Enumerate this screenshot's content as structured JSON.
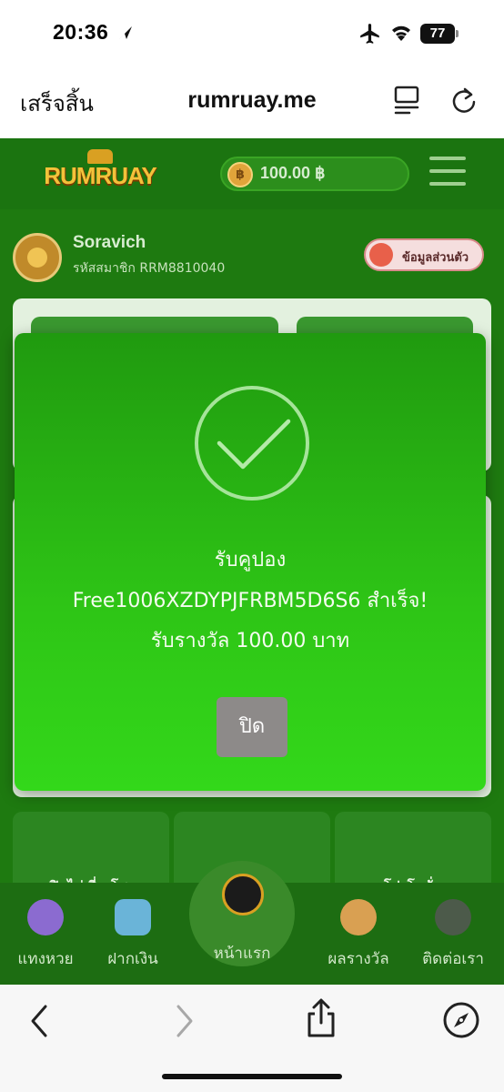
{
  "status_bar": {
    "time": "20:36",
    "battery": "77"
  },
  "browser": {
    "done_label": "เสร็จสิ้น",
    "url": "rumruay.me"
  },
  "site": {
    "logo_text": "RUMRUAY",
    "balance": "100.00 ฿",
    "coin_symbol": "฿",
    "user": {
      "name": "Soravich",
      "member_id": "รหัสสมาชิก RRM8810040",
      "profile_button": "ข้อมูลส่วนตัว"
    },
    "tiles": [
      {
        "label": "เปิดไพ่เสี่ยงโชค"
      },
      {
        "label": "วงล้อนำโชค"
      },
      {
        "label": "โปรโมชั่น"
      }
    ],
    "bottom_nav": [
      {
        "label": "แทงหวย",
        "icon": "lottery-balls-icon"
      },
      {
        "label": "ฝากเงิน",
        "icon": "deposit-icon"
      },
      {
        "label": "หน้าแรก",
        "icon": "home-icon"
      },
      {
        "label": "ผลรางวัล",
        "icon": "medal-icon"
      },
      {
        "label": "ติดต่อเรา",
        "icon": "contact-icon"
      }
    ]
  },
  "modal": {
    "line1": "รับคูปอง",
    "line2": "Free1006XZDYPJFRBM5D6S6  สำเร็จ!",
    "line3": "รับรางวัล 100.00 บาท",
    "close_label": "ปิด",
    "accent": "#2ec516"
  },
  "toolbar": {
    "icons": [
      "back-icon",
      "forward-icon",
      "share-icon",
      "compass-icon"
    ]
  }
}
